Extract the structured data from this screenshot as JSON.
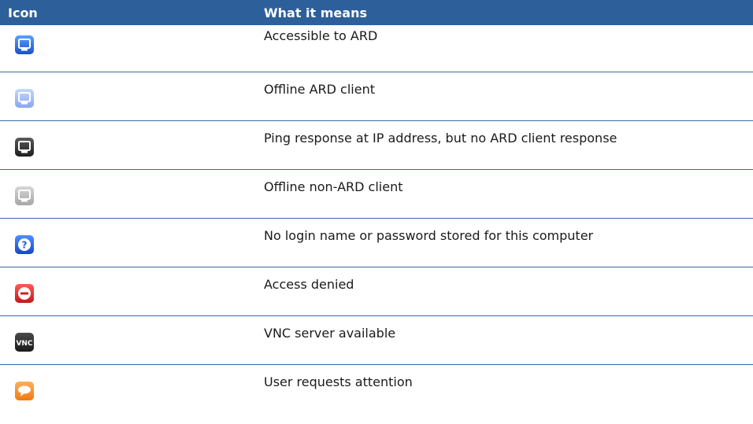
{
  "header": {
    "icon_label": "Icon",
    "meaning_label": "What it means"
  },
  "rows": [
    {
      "icon": "ard-accessible-icon",
      "meaning": "Accessible to ARD"
    },
    {
      "icon": "ard-offline-icon",
      "meaning": "Offline ARD client"
    },
    {
      "icon": "ping-only-icon",
      "meaning": "Ping response at IP address, but no ARD client response"
    },
    {
      "icon": "offline-non-ard-icon",
      "meaning": "Offline non-ARD client"
    },
    {
      "icon": "question-icon",
      "meaning": "No login name or password stored for this computer"
    },
    {
      "icon": "access-denied-icon",
      "meaning": "Access denied"
    },
    {
      "icon": "vnc-icon",
      "meaning": "VNC server available",
      "icon_text": "VNC"
    },
    {
      "icon": "attention-icon",
      "meaning": "User requests attention"
    }
  ],
  "colors": {
    "header_bg": "#2d5f9b",
    "divider": "#3a67a6"
  }
}
